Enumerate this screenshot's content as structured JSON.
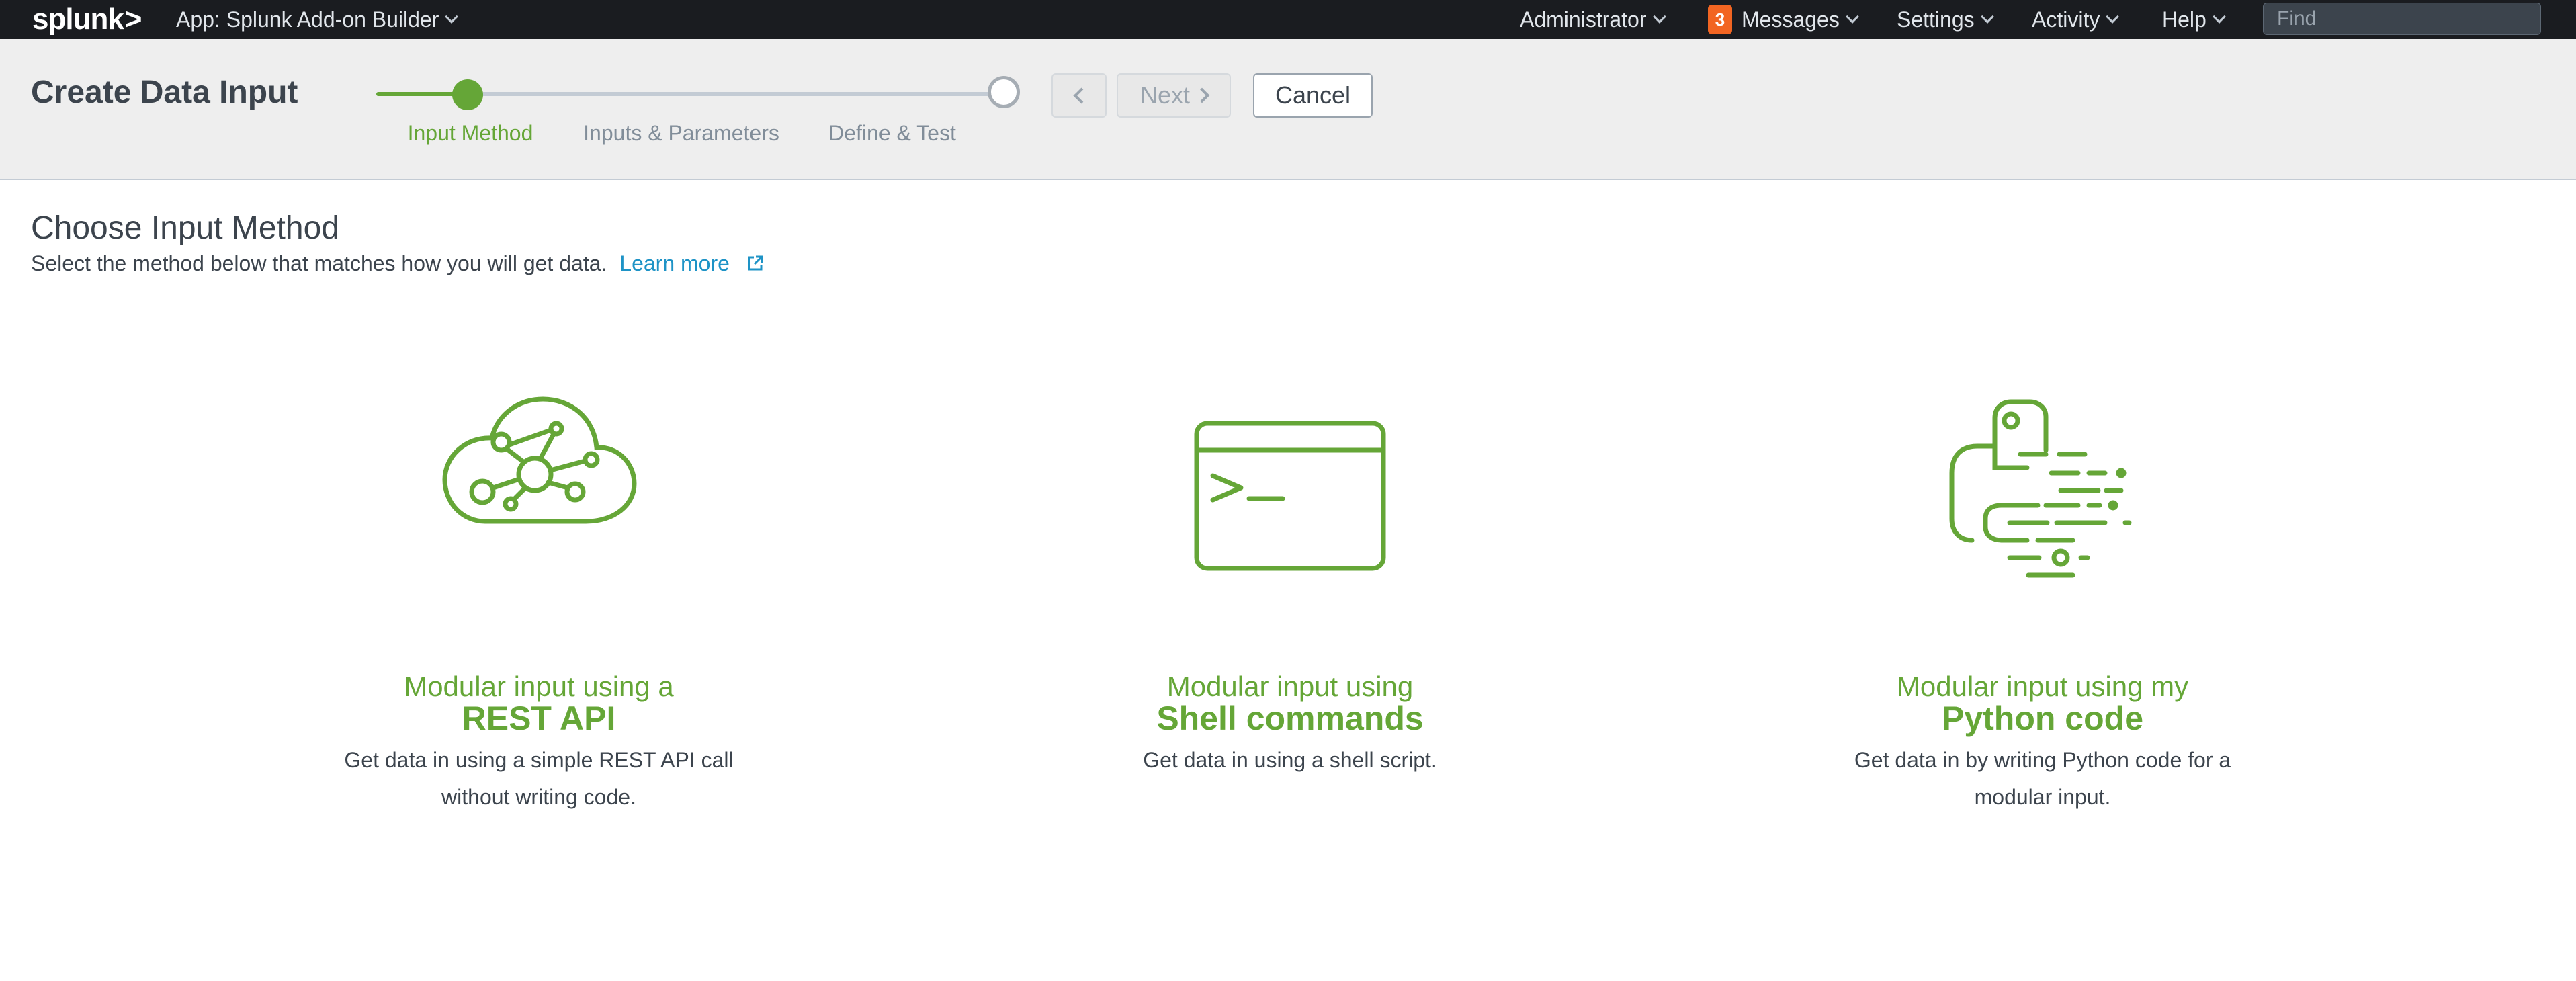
{
  "topbar": {
    "logo": "splunk",
    "logo_mark": ">",
    "app": "App: Splunk Add-on Builder",
    "user": "Administrator",
    "messages_count": "3",
    "messages": "Messages",
    "settings": "Settings",
    "activity": "Activity",
    "help": "Help",
    "find_placeholder": "Find"
  },
  "header": {
    "title": "Create Data Input",
    "steps": [
      {
        "label": "Input Method",
        "active": true
      },
      {
        "label": "Inputs & Parameters",
        "active": false
      },
      {
        "label": "Define & Test",
        "active": false
      }
    ],
    "next_label": "Next",
    "cancel_label": "Cancel"
  },
  "main": {
    "title": "Choose Input Method",
    "description": "Select the method below that matches how you will get data.",
    "learn_more": "Learn more",
    "cards": [
      {
        "line1": "Modular input using a",
        "line2": "REST API",
        "desc": "Get data in using a simple REST API call without writing code.",
        "icon": "cloud-network-icon"
      },
      {
        "line1": "Modular input using",
        "line2": "Shell commands",
        "desc": "Get data in using a shell script.",
        "icon": "terminal-icon"
      },
      {
        "line1": "Modular input using my",
        "line2": "Python code",
        "desc": "Get data in by writing Python code for a modular input.",
        "icon": "python-icon"
      }
    ]
  },
  "colors": {
    "accent": "#65a637",
    "link": "#1e93c6",
    "topbar_bg": "#1a1c20",
    "badge": "#f26522",
    "header_bg": "#eeeeee"
  }
}
